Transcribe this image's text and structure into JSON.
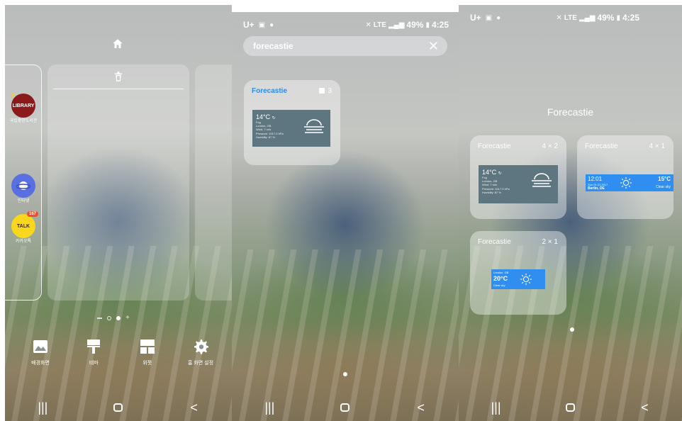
{
  "status_bar": {
    "carrier": "U+",
    "time": "4:25",
    "battery": "49%",
    "network": "LTE"
  },
  "panel1": {
    "apps": [
      {
        "label_top": "LIBRARY",
        "label": "국립중앙도서관",
        "color": "#8b1a1a"
      },
      {
        "label": "인터넷",
        "color": "#5a6fe0"
      },
      {
        "label": "카카오톡",
        "badge": "167",
        "icon_text": "TALK",
        "color": "#f9d71c"
      }
    ],
    "toolbar": [
      {
        "label": "배경화면",
        "icon": "wallpaper-icon"
      },
      {
        "label": "테마",
        "icon": "theme-brush-icon"
      },
      {
        "label": "위젯",
        "icon": "widget-icon"
      },
      {
        "label": "홈 화면 설정",
        "icon": "gear-icon"
      }
    ]
  },
  "panel2": {
    "search": {
      "value": "forecastie"
    },
    "result": {
      "title": "Forecastie",
      "count": "3"
    }
  },
  "panel3": {
    "title": "Forecastie",
    "widgets": [
      {
        "name": "Forecastie",
        "size": "4 × 2"
      },
      {
        "name": "Forecastie",
        "size": "4 × 1"
      },
      {
        "name": "Forecastie",
        "size": "2 × 1"
      }
    ]
  },
  "widget_large": {
    "temp": "14°C",
    "desc": "Fog",
    "city": "London, GB",
    "wind": "Wind: 7 m/s",
    "pressure": "Pressure: 1017.0 hPa",
    "humidity": "Humidity: 87 %"
  },
  "widget_wide": {
    "time": "12:01",
    "date": "Sun 01.01.2017",
    "city": "Berlin, DE",
    "temp": "15°C",
    "desc": "Clear sky"
  },
  "widget_small": {
    "city": "London, GB",
    "temp": "20°C",
    "desc": "Clear sky"
  }
}
